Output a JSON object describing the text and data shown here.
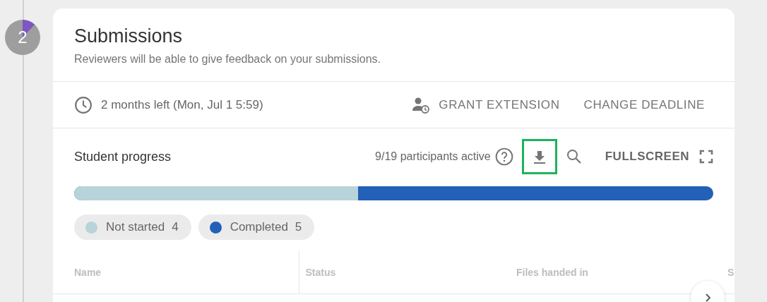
{
  "step": {
    "number": "2"
  },
  "card": {
    "title": "Submissions",
    "subtitle": "Reviewers will be able to give feedback on your submissions.",
    "deadline": "2 months left (Mon, Jul 1 5:59)",
    "actions": [
      {
        "label": "GRANT EXTENSION",
        "kind": "extension"
      },
      {
        "label": "CHANGE DEADLINE",
        "kind": "plain"
      }
    ],
    "progress": {
      "title": "Student progress",
      "active": "9/19 participants active",
      "download_highlighted": true,
      "fullscreen": "FULLSCREEN",
      "level": 0.444,
      "segments": [
        {
          "label": "Not started",
          "count": "4",
          "color": "#b8d3da"
        },
        {
          "label": "Completed",
          "count": "5",
          "color": "#2360b7"
        }
      ]
    },
    "table": {
      "columns": [
        "Name",
        "Status",
        "Files handed in",
        "S"
      ]
    }
  }
}
